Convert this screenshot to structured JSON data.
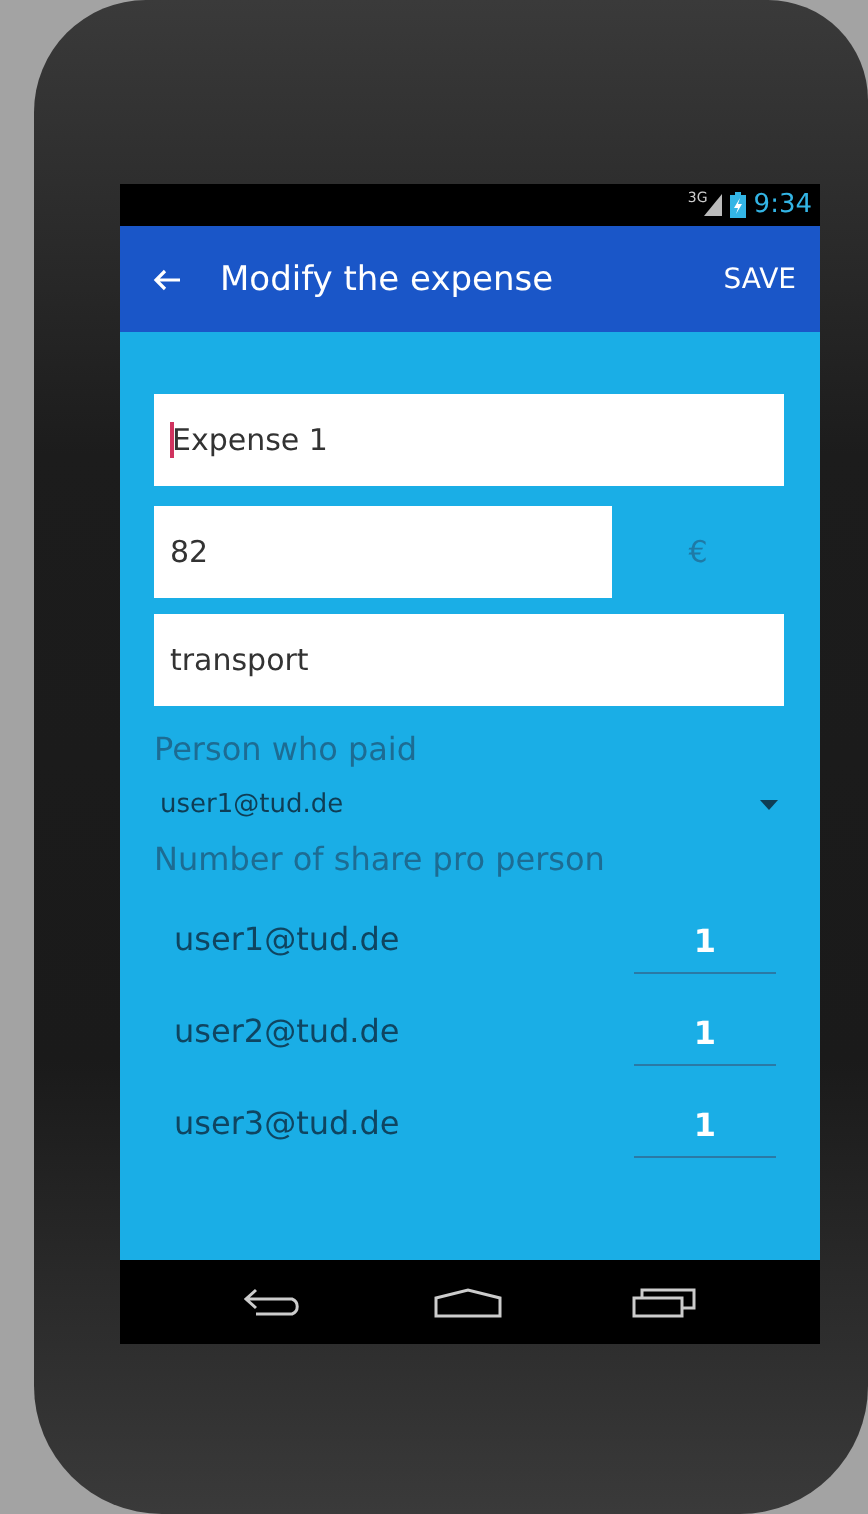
{
  "status_bar": {
    "network": "3G",
    "time": "9:34"
  },
  "toolbar": {
    "title": "Modify the expense",
    "action": "SAVE"
  },
  "name_field": {
    "value": "Expense 1",
    "focused": true
  },
  "amount_field": {
    "value": "82",
    "currency": "€"
  },
  "category_field": {
    "value": "transport"
  },
  "payer": {
    "label": "Person who paid",
    "value": "user1@tud.de"
  },
  "shares": {
    "label": "Number of share pro person",
    "rows": [
      {
        "user": "user1@tud.de",
        "value": "1"
      },
      {
        "user": "user2@tud.de",
        "value": "1"
      },
      {
        "user": "user3@tud.de",
        "value": "1"
      }
    ]
  }
}
